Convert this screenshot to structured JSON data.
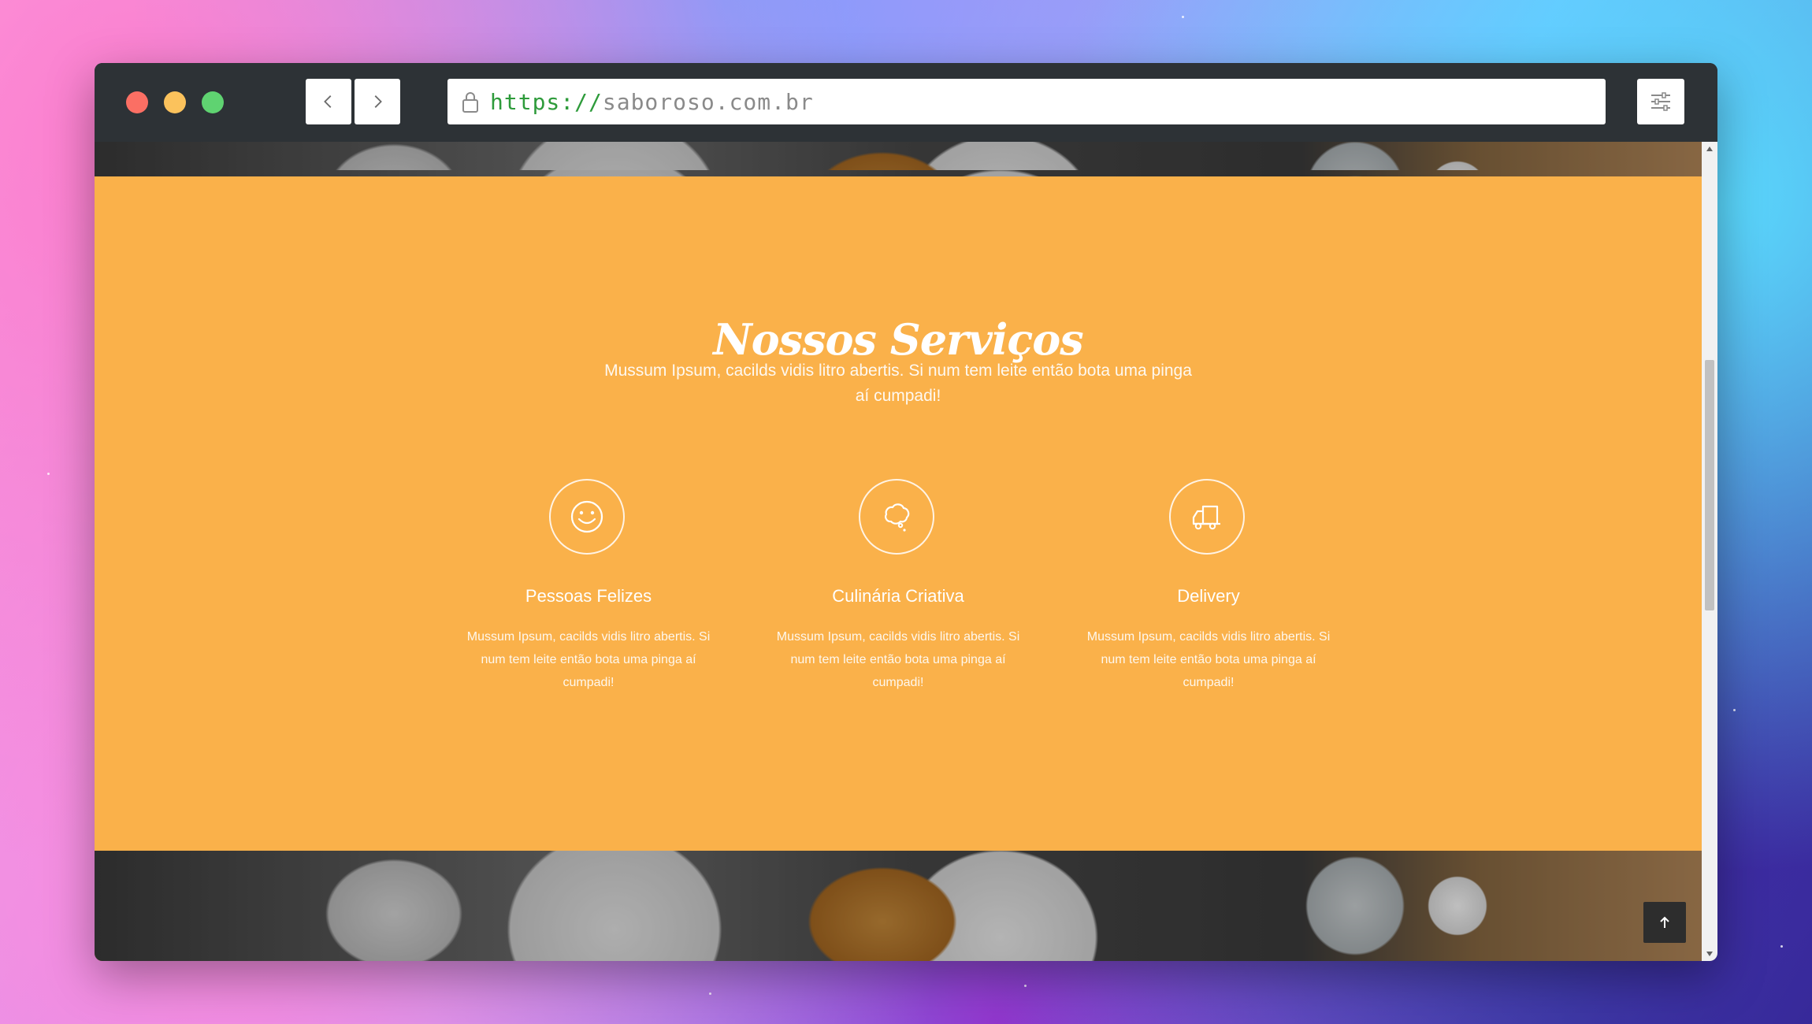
{
  "browser": {
    "url_scheme": "https://",
    "url_host": "saboroso.com.br",
    "icons": {
      "back": "chevron-left-icon",
      "forward": "chevron-right-icon",
      "lock": "lock-icon",
      "settings": "sliders-icon"
    }
  },
  "services": {
    "title": "Nossos Serviços",
    "subtitle": "Mussum Ipsum, cacilds vidis litro abertis. Si num tem leite então bota uma pinga aí cumpadi!",
    "items": [
      {
        "title": "Pessoas Felizes",
        "description": "Mussum Ipsum, cacilds vidis litro abertis. Si num tem leite então bota uma pinga aí cumpadi!",
        "icon": "smiley-icon"
      },
      {
        "title": "Culinária Criativa",
        "description": "Mussum Ipsum, cacilds vidis litro abertis. Si num tem leite então bota uma pinga aí cumpadi!",
        "icon": "thought-bubble-icon"
      },
      {
        "title": "Delivery",
        "description": "Mussum Ipsum, cacilds vidis litro abertis. Si num tem leite então bota uma pinga aí cumpadi!",
        "icon": "truck-icon"
      }
    ]
  },
  "scroll_to_top": {
    "icon": "arrow-up-icon"
  },
  "colors": {
    "section_background": "#fab14a",
    "titlebar": "#2d3236",
    "url_scheme": "#2e9b3b",
    "url_host": "#8a8a8a"
  }
}
